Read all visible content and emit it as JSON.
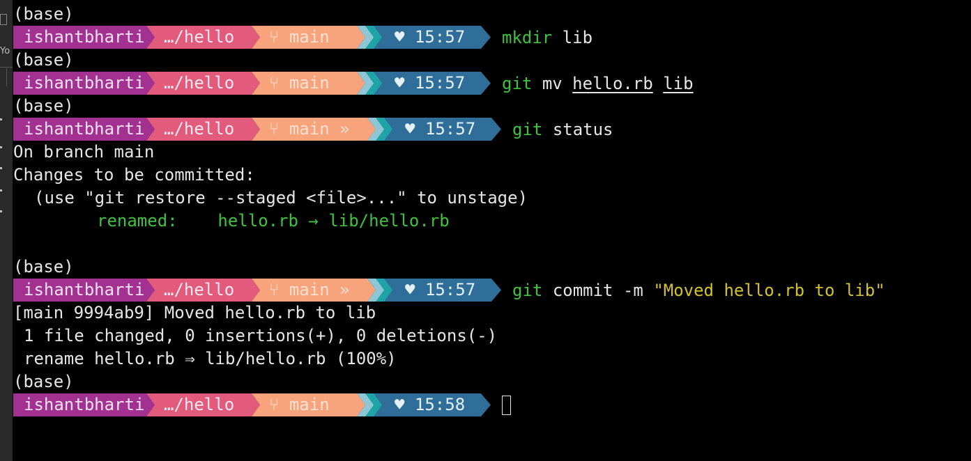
{
  "sidebar": {
    "fragment_text": "Yo"
  },
  "colors": {
    "bg": "#000000",
    "user_segment": "#a23191",
    "path_segment": "#e25b7d",
    "git_segment": "#f7a37c",
    "accent1": "#8fc6d6",
    "accent2": "#1ea4a6",
    "time_segment": "#2e6e98",
    "command_green": "#3fc33f",
    "string_yellow": "#d4c22a"
  },
  "icons": {
    "branch": "git-branch-icon",
    "heart": "heart-icon"
  },
  "base_label": "(base)",
  "prompt": {
    "user": "ishantbharti",
    "path": "…/hello",
    "branch": "main",
    "ahead": "»",
    "heart": "♥"
  },
  "entries": [
    {
      "time": "15:57",
      "cmd": "mkdir",
      "args": "lib"
    },
    {
      "time": "15:57",
      "cmd": "git",
      "args_plain": "mv",
      "arg1": "hello.rb",
      "arg2": "lib"
    },
    {
      "time": "15:57",
      "cmd": "git",
      "args": "status"
    },
    {
      "time": "15:57",
      "cmd": "git",
      "args": "commit -m",
      "string": "\"Moved hello.rb to lib\""
    },
    {
      "time": "15:58"
    }
  ],
  "status_output": {
    "line1": "On branch main",
    "line2": "Changes to be committed:",
    "line3": "(use \"git restore --staged <file>...\" to unstage)",
    "renamed_label": "renamed:",
    "renamed_value": "hello.rb → lib/hello.rb"
  },
  "commit_output": {
    "line1": "[main 9994ab9] Moved hello.rb to lib",
    "line2": "1 file changed, 0 insertions(+), 0 deletions(-)",
    "line3": "rename hello.rb ⇒ lib/hello.rb (100%)"
  }
}
